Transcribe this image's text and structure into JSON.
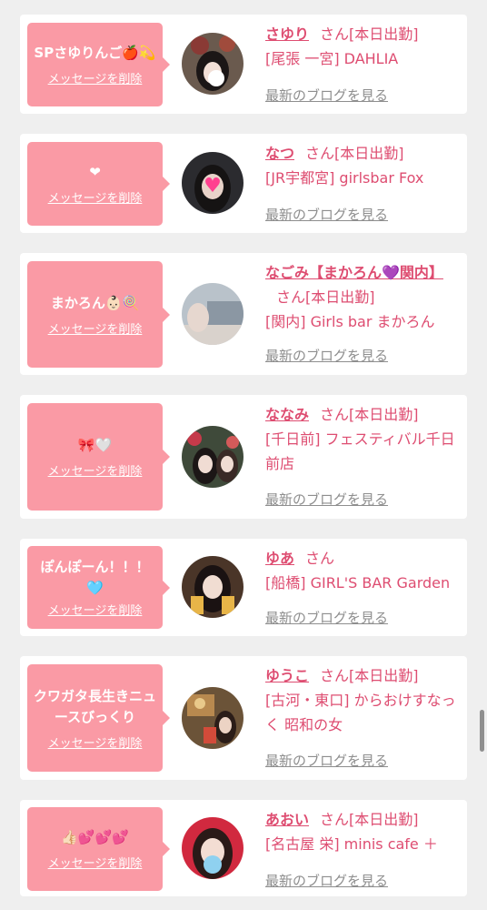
{
  "delete_label": "メッセージを削除",
  "san_label": "さん",
  "blog_label": "最新のブログを見る",
  "colors": {
    "bubble": "#fa9aa5",
    "name": "#de4d71",
    "page_bg": "#efefef",
    "blog_link": "#8e8e8e"
  },
  "items": [
    {
      "message": "SPさゆりんご🍎💫",
      "name": "さゆり",
      "status": "[本日出勤]",
      "shop": "[尾張 一宮] DAHLIA"
    },
    {
      "message": "❤",
      "name": "なつ",
      "status": "[本日出勤]",
      "shop": "[JR宇都宮] girlsbar Fox"
    },
    {
      "message": "まかろん👶🏻🍭",
      "name": "なごみ【まかろん💜関内】",
      "status": "[本日出勤]",
      "shop": "[関内] Girls bar まかろん"
    },
    {
      "message": "🎀🤍",
      "name": "ななみ",
      "status": "[本日出勤]",
      "shop": "[千日前] フェスティバル千日前店"
    },
    {
      "message": "ぽんぽーん！！！🩵",
      "name": "ゆあ",
      "status": "",
      "shop": "[船橋] GIRL'S BAR Garden"
    },
    {
      "message": "クワガタ長生きニュースびっくり",
      "name": "ゆうこ",
      "status": "[本日出勤]",
      "shop": "[古河・東口] からおけすなっく 昭和の女"
    },
    {
      "message": "👍🏻💕💕💕",
      "name": "あおい",
      "status": "[本日出勤]",
      "shop": "[名古屋 栄] minis cafe ＋"
    }
  ]
}
